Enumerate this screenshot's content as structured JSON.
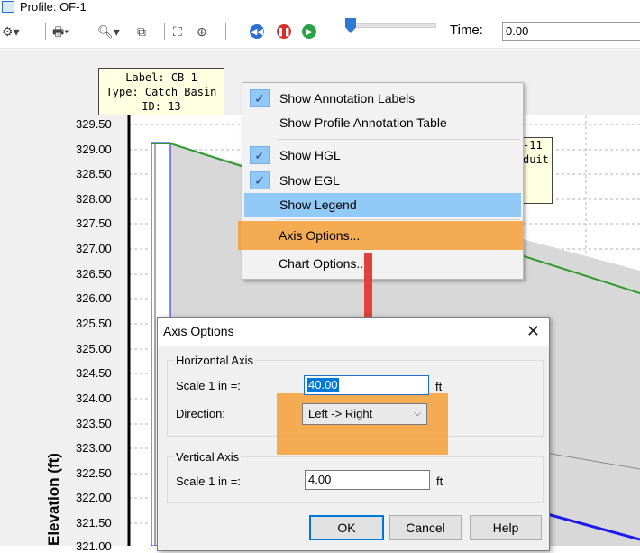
{
  "window": {
    "title": "Profile:  OF-1"
  },
  "toolbar": {
    "icons": [
      "settings-icon",
      "printer-icon",
      "zoom-icon",
      "copy-icon",
      "zoom-extents-icon",
      "zoom-in-icon",
      "rewind-icon",
      "pause-icon",
      "play-icon"
    ],
    "time_label": "Time:",
    "time_value": "0.00",
    "slider_position": 0.0
  },
  "chart": {
    "y_axis_title": "Elevation (ft)",
    "y_ticks": [
      "329.50",
      "329.00",
      "328.50",
      "328.00",
      "327.50",
      "327.00",
      "326.50",
      "326.00",
      "325.50",
      "325.00",
      "324.50",
      "324.00",
      "323.50",
      "323.00",
      "322.50",
      "322.00",
      "321.50",
      "321.00"
    ],
    "colors": {
      "hgl": "#2e9a2e",
      "egl": "#1a1aee",
      "conduit_fill": "#d8d8d8",
      "grid": "#b0b0b0"
    }
  },
  "annotation_cb1": {
    "line1": "Label: CB-1",
    "line2": "Type: Catch Basin",
    "line3": "ID: 13"
  },
  "annotation_conduit": {
    "line1": "-11",
    "line2": "duit"
  },
  "context_menu": {
    "items": [
      {
        "label": "Show Annotation Labels",
        "checked": true
      },
      {
        "label": "Show Profile Annotation Table",
        "checked": false
      },
      {
        "label": "Show HGL",
        "checked": true
      },
      {
        "label": "Show EGL",
        "checked": true
      },
      {
        "label": "Show Legend",
        "checked": false,
        "highlighted": true
      },
      {
        "label": "Axis Options...",
        "checked": false,
        "emphasized": true
      },
      {
        "label": "Chart Options...",
        "checked": false
      }
    ]
  },
  "dialog": {
    "title": "Axis Options",
    "horizontal_group": "Horizontal Axis",
    "h_scale_label": "Scale 1 in =:",
    "h_scale_value": "40.00",
    "h_unit": "ft",
    "direction_label": "Direction:",
    "direction_value": "Left -> Right",
    "vertical_group": "Vertical Axis",
    "v_scale_label": "Scale 1 in =:",
    "v_scale_value": "4.00",
    "v_unit": "ft",
    "ok_label": "OK",
    "cancel_label": "Cancel",
    "help_label": "Help"
  }
}
